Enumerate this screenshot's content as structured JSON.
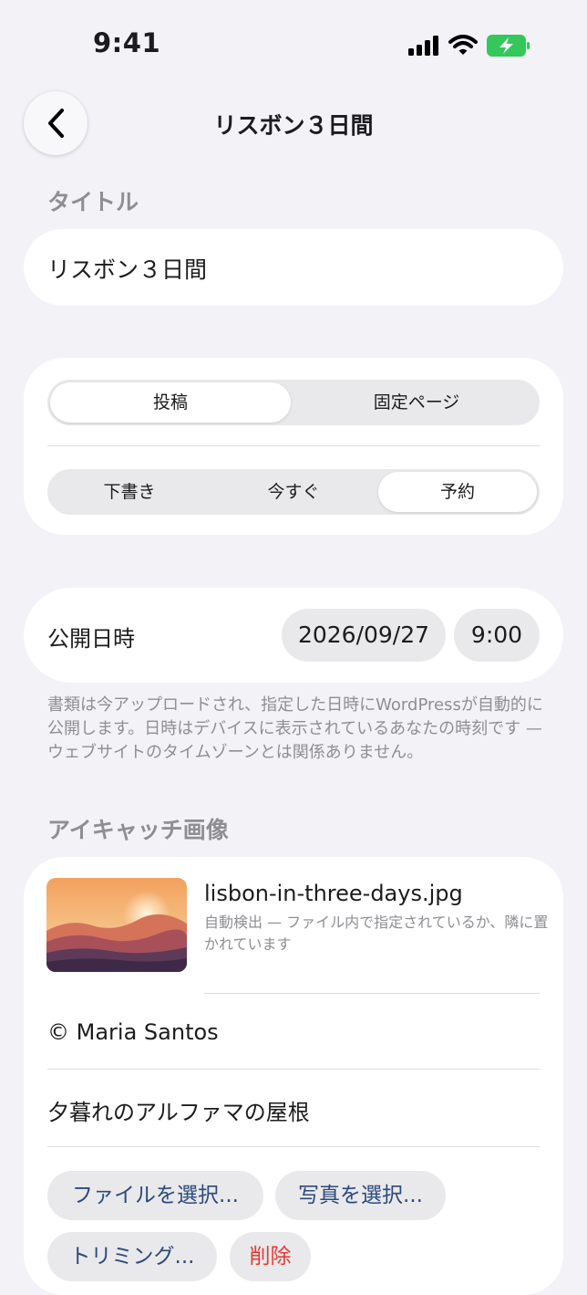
{
  "status_bar": {
    "time": "9:41"
  },
  "nav": {
    "title": "リスボン３日間"
  },
  "title_section": {
    "label": "タイトル",
    "value": "リスボン３日間"
  },
  "post_type": {
    "options": [
      "投稿",
      "固定ページ"
    ],
    "selected": "投稿"
  },
  "publish_mode": {
    "options": [
      "下書き",
      "今すぐ",
      "予約"
    ],
    "selected": "予約"
  },
  "schedule": {
    "label": "公開日時",
    "date": "2026/09/27",
    "time": "9:00"
  },
  "footnote": "書類は今アップロードされ、指定した日時にWordPressが自動的に公開します。日時はデバイスに表示されているあなたの時刻です — ウェブサイトのタイムゾーンとは関係ありません。",
  "featured_image": {
    "label": "アイキャッチ画像",
    "filename": "lisbon-in-three-days.jpg",
    "detection_note": "自動検出 — ファイル内で指定されているか、隣に置かれています",
    "credit": "© Maria Santos",
    "caption": "夕暮れのアルファマの屋根",
    "actions": {
      "choose_file": "ファイルを選択...",
      "choose_photo": "写真を選択...",
      "crop": "トリミング...",
      "delete": "削除"
    }
  },
  "colors": {
    "background": "#f2f2f7",
    "card": "#ffffff",
    "action_text": "#2c4a7c",
    "destructive": "#e53935",
    "battery": "#34c759"
  },
  "icons": [
    "signal-icon",
    "wifi-icon",
    "battery-charging-icon",
    "chevron-left-icon"
  ]
}
